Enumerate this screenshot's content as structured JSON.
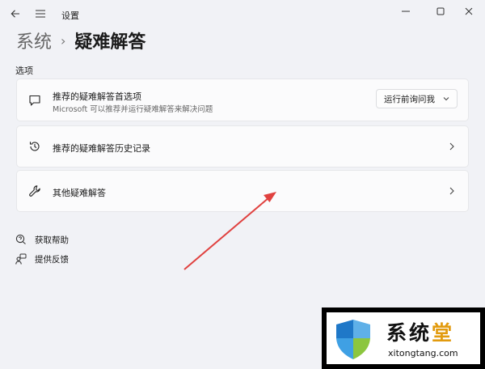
{
  "titlebar": {
    "back_icon": "back-arrow-icon",
    "menu_icon": "hamburger-menu-icon",
    "title": "设置"
  },
  "breadcrumb": {
    "parent": "系统",
    "current": "疑难解答"
  },
  "section": {
    "label": "选项"
  },
  "cards": [
    {
      "title": "推荐的疑难解答首选项",
      "description": "Microsoft 可以推荐并运行疑难解答来解决问题",
      "icon": "chat-bubble-icon",
      "dropdown_value": "运行前询问我"
    },
    {
      "title": "推荐的疑难解答历史记录",
      "icon": "history-icon"
    },
    {
      "title": "其他疑难解答",
      "icon": "wrench-icon"
    }
  ],
  "links": [
    {
      "label": "获取帮助",
      "icon": "help-chat-icon"
    },
    {
      "label": "提供反馈",
      "icon": "feedback-person-icon"
    }
  ],
  "watermark": {
    "name_part1": "系统",
    "name_part2": "堂",
    "url": "xitongtang.com"
  },
  "colors": {
    "background": "#f1f2f6",
    "card": "#fbfbfc",
    "arrow": "#e0413f",
    "watermark_accent": "#e29b0f"
  }
}
